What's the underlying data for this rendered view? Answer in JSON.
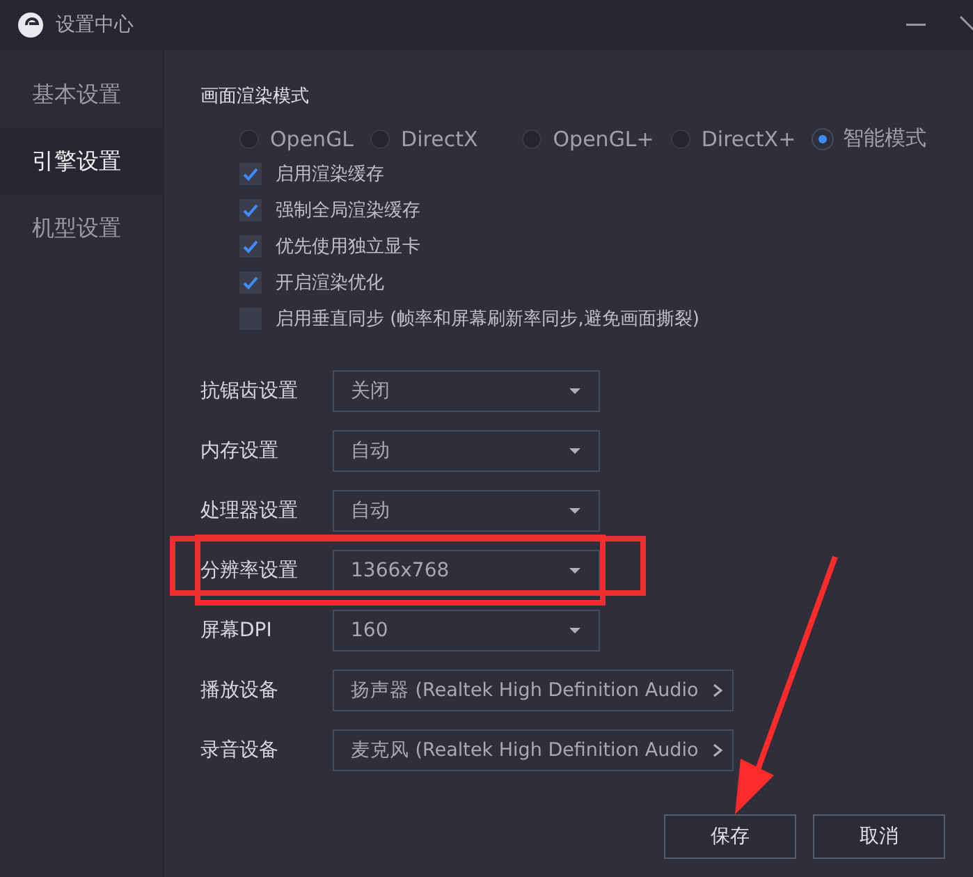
{
  "window": {
    "title": "设置中心"
  },
  "sidebar": {
    "items": [
      {
        "label": "基本设置",
        "selected": false
      },
      {
        "label": "引擎设置",
        "selected": true
      },
      {
        "label": "机型设置",
        "selected": false
      }
    ]
  },
  "render_mode": {
    "title": "画面渲染模式",
    "options": [
      {
        "label": "OpenGL",
        "selected": false
      },
      {
        "label": "DirectX",
        "selected": false
      },
      {
        "label": "OpenGL+",
        "selected": false
      },
      {
        "label": "DirectX+",
        "selected": false
      },
      {
        "label": "智能模式",
        "selected": true
      }
    ],
    "checkboxes": [
      {
        "label": "启用渲染缓存",
        "checked": true
      },
      {
        "label": "强制全局渲染缓存",
        "checked": true
      },
      {
        "label": "优先使用独立显卡",
        "checked": true
      },
      {
        "label": "开启渲染优化",
        "checked": true
      },
      {
        "label": "启用垂直同步 (帧率和屏幕刷新率同步,避免画面撕裂)",
        "checked": false
      }
    ]
  },
  "settings": [
    {
      "label": "抗锯齿设置",
      "value": "关闭",
      "kind": "select",
      "highlighted": false
    },
    {
      "label": "内存设置",
      "value": "自动",
      "kind": "select",
      "highlighted": false
    },
    {
      "label": "处理器设置",
      "value": "自动",
      "kind": "select",
      "highlighted": false
    },
    {
      "label": "分辨率设置",
      "value": "1366x768",
      "kind": "select",
      "highlighted": true
    },
    {
      "label": "屏幕DPI",
      "value": "160",
      "kind": "select",
      "highlighted": false
    },
    {
      "label": "播放设备",
      "value": "扬声器 (Realtek High Definition Audio",
      "kind": "device",
      "highlighted": false
    },
    {
      "label": "录音设备",
      "value": "麦克风 (Realtek High Definition Audio",
      "kind": "device",
      "highlighted": false
    }
  ],
  "buttons": [
    "保存",
    "取消"
  ]
}
